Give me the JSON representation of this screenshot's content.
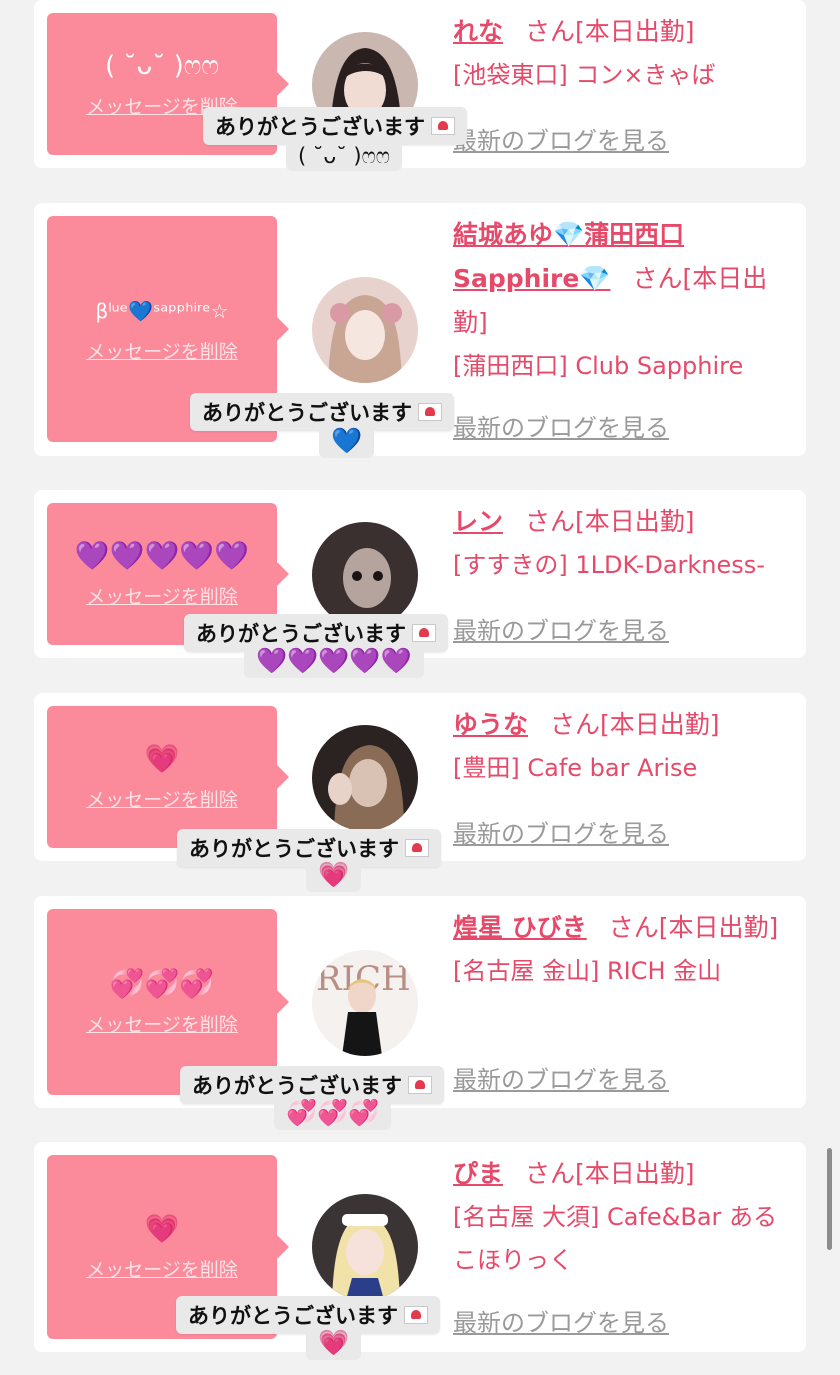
{
  "tooltip_text": "ありがとうございます",
  "delete_label": "メッセージを削除",
  "blog_label": "最新のブログを見る",
  "san_label": "さん",
  "cards": [
    {
      "message": "( ˘ᴗ˘ )ෆෆ",
      "name": "れな",
      "status": "[本日出勤]",
      "shop": "[池袋東口] コン×きゃば",
      "reaction": "( ˘ᴗ˘ )ෆෆ"
    },
    {
      "message": "βˡᵘᵉ💙ˢᵃᵖᵖʰⁱʳᵉ☆",
      "name": "結城あゆ💎蒲田西口Sapphire💎",
      "status": "[本日出勤]",
      "shop": "[蒲田西口] Club Sapphire",
      "reaction": "💙"
    },
    {
      "message": "💜💜💜💜💜",
      "name": "レン",
      "status": "[本日出勤]",
      "shop": "[すすきの] 1LDK-Darkness-",
      "reaction": "💜💜💜💜💜"
    },
    {
      "message": "💗",
      "name": "ゆうな",
      "status": "[本日出勤]",
      "shop": "[豊田] Cafe bar Arise",
      "reaction": "💗"
    },
    {
      "message": "💞💞💞",
      "name": "煌星 ひびき",
      "status": "[本日出勤]",
      "shop": "[名古屋 金山] RICH 金山",
      "reaction": "💞💞💞"
    },
    {
      "message": "💗",
      "name": "ぴま",
      "status": "[本日出勤]",
      "shop": "[名古屋 大須] Cafe&Bar あるこほりっく",
      "reaction": "💗"
    }
  ],
  "colors": {
    "accent": "#e64a6a",
    "bubble": "#fb8b9b",
    "link_gray": "#9a9a9a",
    "background": "#f2f2f2"
  }
}
